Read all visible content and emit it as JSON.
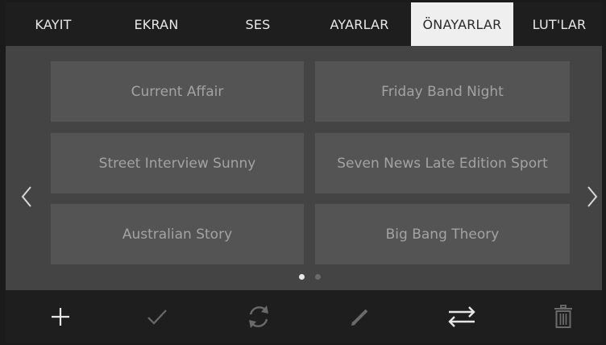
{
  "tabs": [
    {
      "label": "KAYIT"
    },
    {
      "label": "EKRAN"
    },
    {
      "label": "SES"
    },
    {
      "label": "AYARLAR"
    },
    {
      "label": "ÖNAYARLAR",
      "active": true
    },
    {
      "label": "LUT'LAR"
    }
  ],
  "presets": [
    {
      "label": "Current Affair"
    },
    {
      "label": "Friday Band Night"
    },
    {
      "label": "Street Interview Sunny"
    },
    {
      "label": "Seven News Late Edition Sport"
    },
    {
      "label": "Australian Story"
    },
    {
      "label": "Big Bang Theory"
    }
  ],
  "pagination": {
    "current_page": 1,
    "total_pages": 2
  },
  "toolbar": {
    "icons": [
      "plus-icon",
      "checkmark-icon",
      "refresh-icon",
      "pencil-icon",
      "swap-arrows-icon",
      "trash-icon"
    ],
    "enabled": [
      true,
      false,
      false,
      false,
      true,
      false
    ]
  },
  "colors": {
    "tab_bar": "#1e1e1e",
    "active_tab_bg": "#efefef",
    "content_bg": "#444444",
    "preset_bg": "#545454",
    "preset_text": "#a3a3a3",
    "icon_enabled": "#e6e6e6",
    "icon_disabled": "#6a6a6a"
  }
}
